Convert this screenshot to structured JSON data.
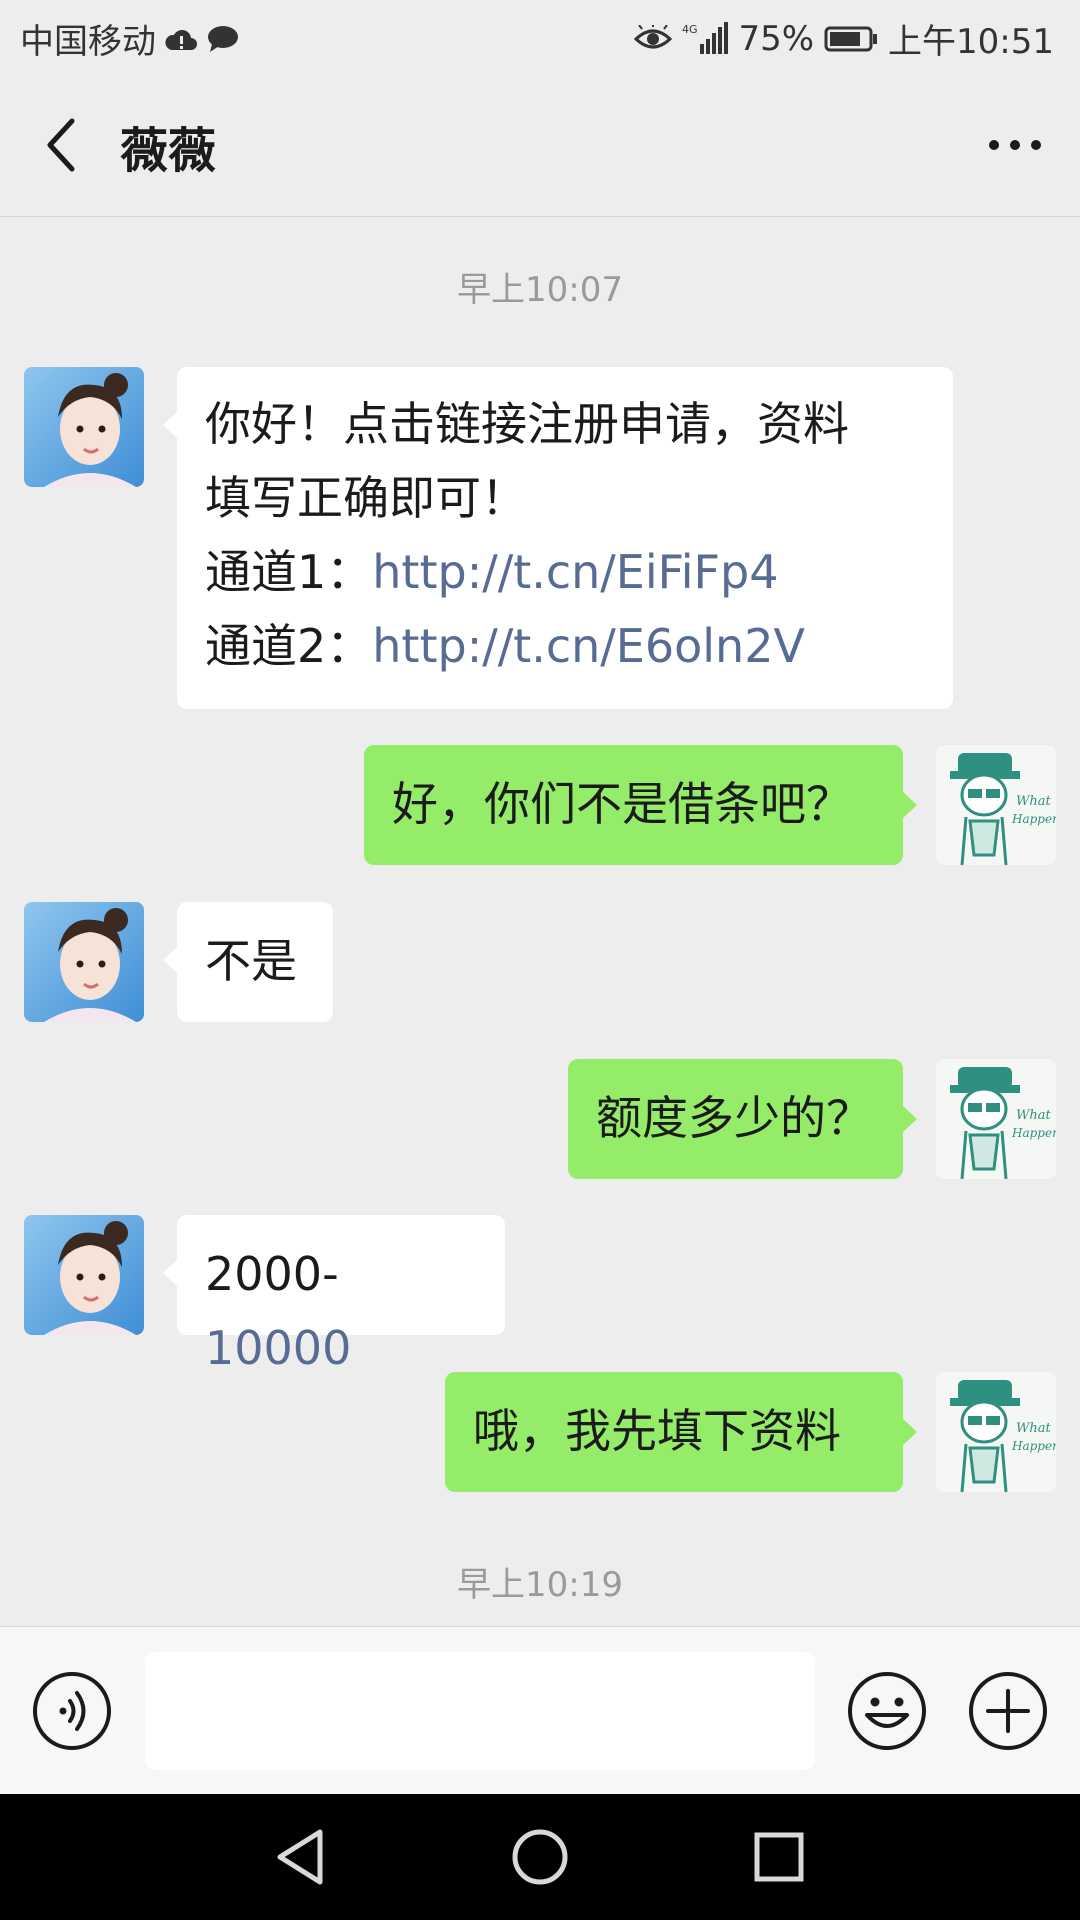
{
  "status_bar": {
    "carrier": "中国移动",
    "network": "4G",
    "battery": "75%",
    "time": "上午10:51",
    "icons": [
      "cloud-alert-icon",
      "chat-notification-icon",
      "eye-icon",
      "signal-icon",
      "battery-icon"
    ]
  },
  "header": {
    "title": "薇薇",
    "icons": [
      "back-arrow-icon",
      "more-dots-icon"
    ]
  },
  "messages": {
    "time1": "早上10:07",
    "m1": {
      "line1": "你好！点击链接注册申请，资料",
      "line2": "填写正确即可！",
      "ch1_label": "通道1：",
      "ch1_link": "http://t.cn/EiFiFp4",
      "ch2_label": "通道2：",
      "ch2_link": "http://t.cn/E6oln2V"
    },
    "m2": "好，你们不是借条吧？",
    "m3": "不是",
    "m4": "额度多少的？",
    "m5": {
      "prefix": "2000-",
      "link": "10000"
    },
    "m6": "哦，我先填下资料",
    "time2": "早上10:19"
  },
  "input_bar": {
    "value": "",
    "icons": [
      "voice-icon",
      "emoji-icon",
      "plus-icon"
    ]
  },
  "nav_bar": {
    "icons": [
      "nav-back-icon",
      "nav-home-icon",
      "nav-recents-icon"
    ]
  },
  "colors": {
    "background": "#ededed",
    "incoming_bubble": "#ffffff",
    "outgoing_bubble": "#95ec69",
    "link": "#576b95",
    "time_label": "#9a9a9a"
  }
}
